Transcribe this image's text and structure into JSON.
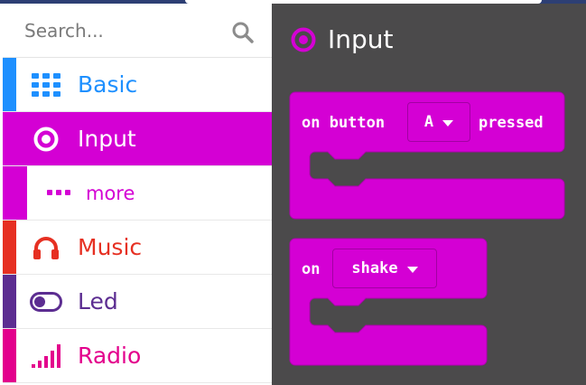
{
  "search": {
    "placeholder": "Search..."
  },
  "categories": [
    {
      "label": "Basic",
      "color": "#1e90ff",
      "icon": "grid-icon"
    },
    {
      "label": "Input",
      "color": "#d400d4",
      "icon": "radio-target-icon",
      "selected": true
    },
    {
      "label": "more",
      "color": "#d400d4",
      "icon": "dots-icon"
    },
    {
      "label": "Music",
      "color": "#e63022",
      "icon": "headphones-icon"
    },
    {
      "label": "Led",
      "color": "#5c2d91",
      "icon": "toggle-icon"
    },
    {
      "label": "Radio",
      "color": "#e3008c",
      "icon": "signal-bars-icon"
    }
  ],
  "flyout": {
    "heading": "Input",
    "block1": {
      "prefix": "on button",
      "dropdown": "A",
      "suffix": "pressed"
    },
    "block2": {
      "prefix": "on",
      "dropdown": "shake"
    },
    "block_color": "#d400d4",
    "background": "#4b4a4b"
  }
}
